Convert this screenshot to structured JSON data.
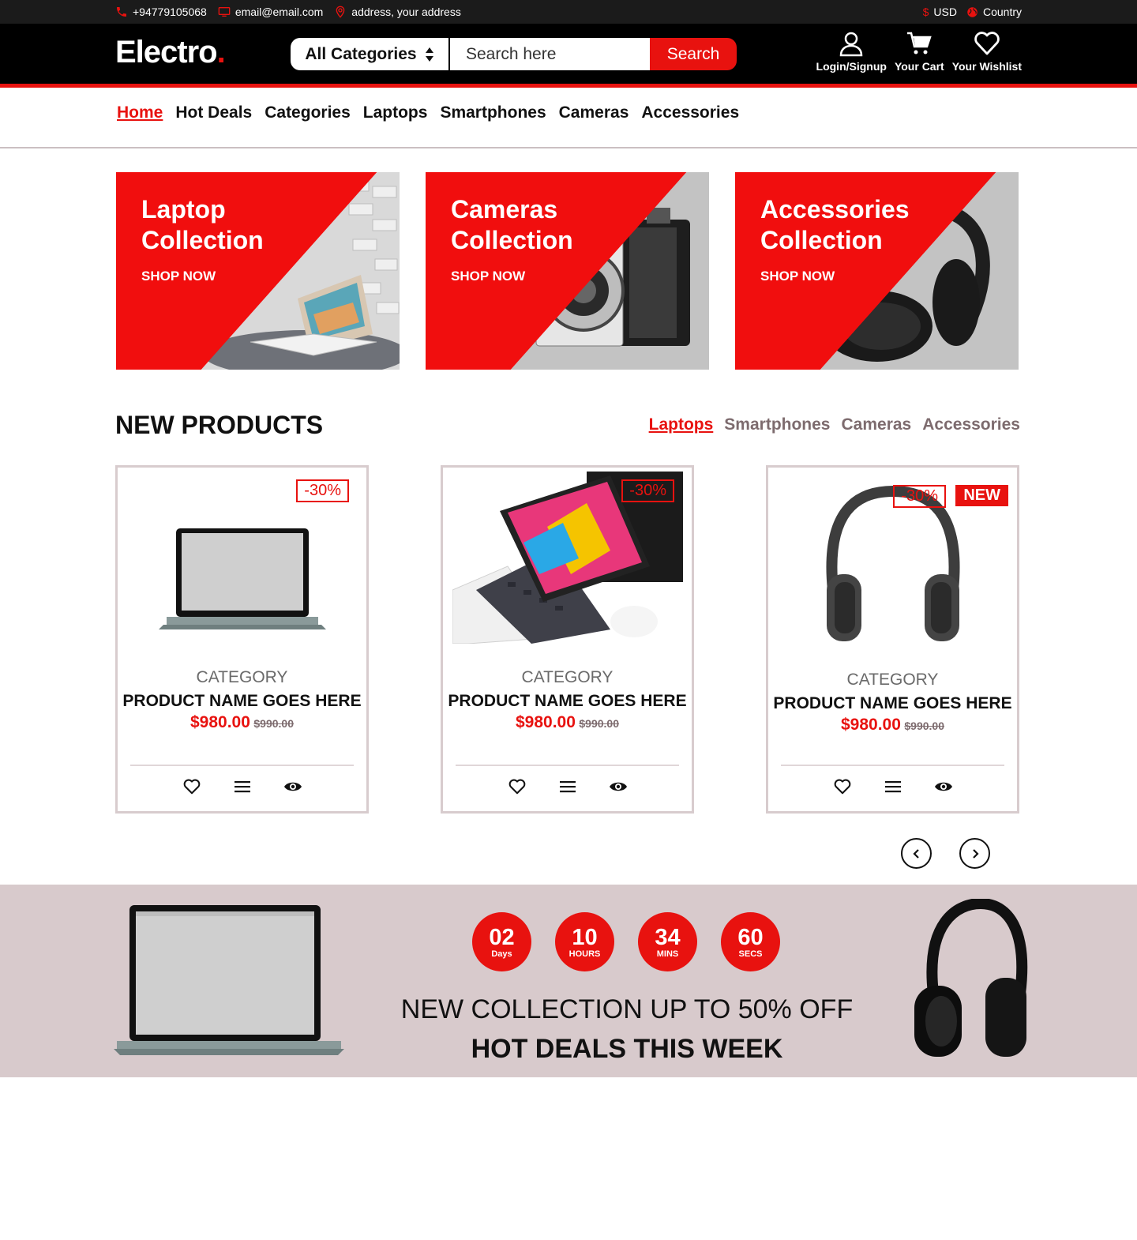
{
  "topbar": {
    "phone": "+94779105068",
    "email": "email@email.com",
    "address": "address, your address",
    "currency": "USD",
    "country": "Country"
  },
  "header": {
    "logo": "Electro",
    "logo_dot": ".",
    "category_select": "All Categories",
    "search_placeholder": "Search here",
    "search_button": "Search",
    "actions": {
      "login": "Login/Signup",
      "cart": "Your Cart",
      "wishlist": "Your Wishlist"
    }
  },
  "nav": [
    "Home",
    "Hot Deals",
    "Categories",
    "Laptops",
    "Smartphones",
    "Cameras",
    "Accessories"
  ],
  "banners": [
    {
      "line1": "Laptop",
      "line2": "Collection",
      "cta": "SHOP NOW"
    },
    {
      "line1": "Cameras",
      "line2": "Collection",
      "cta": "SHOP NOW"
    },
    {
      "line1": "Accessories",
      "line2": "Collection",
      "cta": "SHOP NOW"
    }
  ],
  "new_products": {
    "title": "NEW PRODUCTS",
    "tabs": [
      "Laptops",
      "Smartphones",
      "Cameras",
      "Accessories"
    ],
    "products": [
      {
        "discount": "-30%",
        "category": "CATEGORY",
        "name": "PRODUCT NAME GOES HERE",
        "price": "$980.00",
        "old_price": "$990.00"
      },
      {
        "discount": "-30%",
        "category": "CATEGORY",
        "name": "PRODUCT NAME GOES HERE",
        "price": "$980.00",
        "old_price": "$990.00"
      },
      {
        "discount": "-30%",
        "badge": "NEW",
        "category": "CATEGORY",
        "name": "PRODUCT NAME GOES HERE",
        "price": "$980.00",
        "old_price": "$990.00"
      }
    ]
  },
  "hot_deals": {
    "countdown": [
      {
        "value": "02",
        "unit": "Days"
      },
      {
        "value": "10",
        "unit": "HOURS"
      },
      {
        "value": "34",
        "unit": "MINS"
      },
      {
        "value": "60",
        "unit": "SECS"
      }
    ],
    "subtitle": "NEW COLLECTION UP TO 50% OFF",
    "title": "HOT DEALS THIS WEEK"
  },
  "colors": {
    "accent": "#e8120f",
    "dark": "#000000",
    "deal_bg": "#d8cacc"
  }
}
